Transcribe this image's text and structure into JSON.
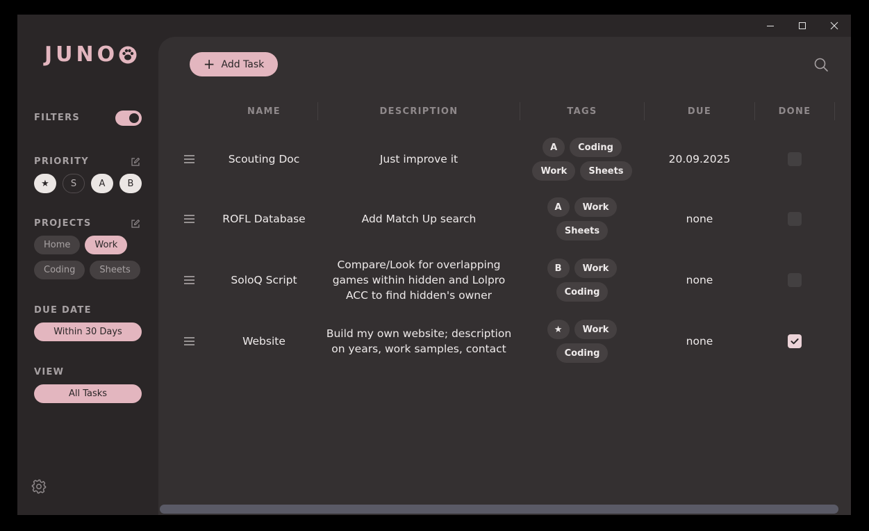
{
  "app": {
    "name": "JUNO"
  },
  "sidebar": {
    "filters_label": "FILTERS",
    "filters_enabled": true,
    "priority_label": "PRIORITY",
    "priorities": [
      {
        "label": "★",
        "selected": true
      },
      {
        "label": "S",
        "selected": false
      },
      {
        "label": "A",
        "selected": true
      },
      {
        "label": "B",
        "selected": true
      }
    ],
    "projects_label": "PROJECTS",
    "projects": [
      {
        "label": "Home",
        "selected": false
      },
      {
        "label": "Work",
        "selected": true
      },
      {
        "label": "Coding",
        "selected": false
      },
      {
        "label": "Sheets",
        "selected": false
      }
    ],
    "due_label": "DUE DATE",
    "due_value": "Within 30 Days",
    "view_label": "VIEW",
    "view_value": "All Tasks"
  },
  "toolbar": {
    "add_label": "Add Task"
  },
  "table": {
    "columns": [
      "NAME",
      "DESCRIPTION",
      "TAGS",
      "DUE",
      "DONE"
    ],
    "rows": [
      {
        "name": "Scouting Doc",
        "description": "Just improve it",
        "tags": [
          "A",
          "Coding",
          "Work",
          "Sheets"
        ],
        "due": "20.09.2025",
        "done": false
      },
      {
        "name": "ROFL Database",
        "description": "Add Match Up search",
        "tags": [
          "A",
          "Work",
          "Sheets"
        ],
        "due": "none",
        "done": false
      },
      {
        "name": "SoloQ Script",
        "description": "Compare/Look for overlapping games within hidden and Lolpro ACC to find hidden's owner",
        "tags": [
          "B",
          "Work",
          "Coding"
        ],
        "due": "none",
        "done": false
      },
      {
        "name": "Website",
        "description": "Build my own website; description on years, work samples, contact",
        "tags": [
          "★",
          "Work",
          "Coding"
        ],
        "due": "none",
        "done": true
      }
    ]
  },
  "colors": {
    "accent": "#e3b6bf",
    "background": "#2a2627",
    "panel": "#343031"
  }
}
